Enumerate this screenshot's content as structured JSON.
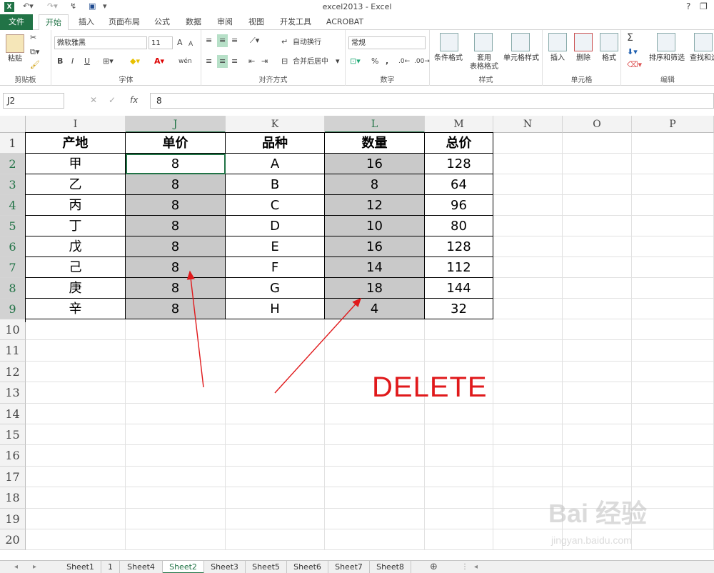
{
  "window": {
    "title": "excel2013 - Excel",
    "help": "?",
    "restore": "❐",
    "app_icon": "X"
  },
  "ribbon_tabs": [
    "文件",
    "开始",
    "插入",
    "页面布局",
    "公式",
    "数据",
    "审阅",
    "视图",
    "开发工具",
    "ACROBAT"
  ],
  "ribbon": {
    "clipboard": {
      "label": "剪贴板",
      "paste": "粘贴"
    },
    "font": {
      "label": "字体",
      "font_name": "微软雅黑",
      "font_size": "11",
      "bold": "B",
      "italic": "I",
      "underline": "U",
      "grow": "A",
      "shrink": "A",
      "wen": "wén"
    },
    "alignment": {
      "label": "对齐方式",
      "wrap": "自动换行",
      "merge": "合并后居中"
    },
    "number": {
      "label": "数字",
      "format": "常规",
      "percent": "%",
      "comma": ","
    },
    "styles": {
      "label": "样式",
      "conditional": "条件格式",
      "table1": "套用",
      "table2": "表格格式",
      "cellstyle": "单元格样式"
    },
    "cells": {
      "label": "单元格",
      "insert": "插入",
      "delete": "删除",
      "format": "格式"
    },
    "editing": {
      "label": "编辑",
      "sigma": "Σ",
      "sort": "排序和筛选",
      "find": "查找和选"
    }
  },
  "formula_bar": {
    "name_box": "J2",
    "cancel": "✕",
    "enter": "✓",
    "fx": "fx",
    "content": "8"
  },
  "columns": [
    "I",
    "J",
    "K",
    "L",
    "M",
    "N",
    "O",
    "P"
  ],
  "rows": [
    "1",
    "2",
    "3",
    "4",
    "5",
    "6",
    "7",
    "8",
    "9",
    "10",
    "11",
    "12",
    "13",
    "14",
    "15",
    "16",
    "17",
    "18",
    "19",
    "20"
  ],
  "table": {
    "headers": [
      "产地",
      "单价",
      "品种",
      "数量",
      "总价"
    ],
    "rows": [
      [
        "甲",
        "8",
        "A",
        "16",
        "128"
      ],
      [
        "乙",
        "8",
        "B",
        "8",
        "64"
      ],
      [
        "丙",
        "8",
        "C",
        "12",
        "96"
      ],
      [
        "丁",
        "8",
        "D",
        "10",
        "80"
      ],
      [
        "戊",
        "8",
        "E",
        "16",
        "128"
      ],
      [
        "己",
        "8",
        "F",
        "14",
        "112"
      ],
      [
        "庚",
        "8",
        "G",
        "18",
        "144"
      ],
      [
        "辛",
        "8",
        "H",
        "4",
        "32"
      ]
    ]
  },
  "annotation": {
    "text": "DELETE",
    "color": "#e0191b"
  },
  "sheet_tabs": [
    "Sheet1",
    "1",
    "Sheet4",
    "Sheet2",
    "Sheet3",
    "Sheet5",
    "Sheet6",
    "Sheet7",
    "Sheet8"
  ],
  "active_sheet": "Sheet2",
  "watermark": {
    "brand": "Bai 经验",
    "url": "jingyan.baidu.com"
  },
  "colors": {
    "accent": "#217346",
    "selection_grey": "#c9c9c9",
    "arrow_red": "#e0191b"
  }
}
